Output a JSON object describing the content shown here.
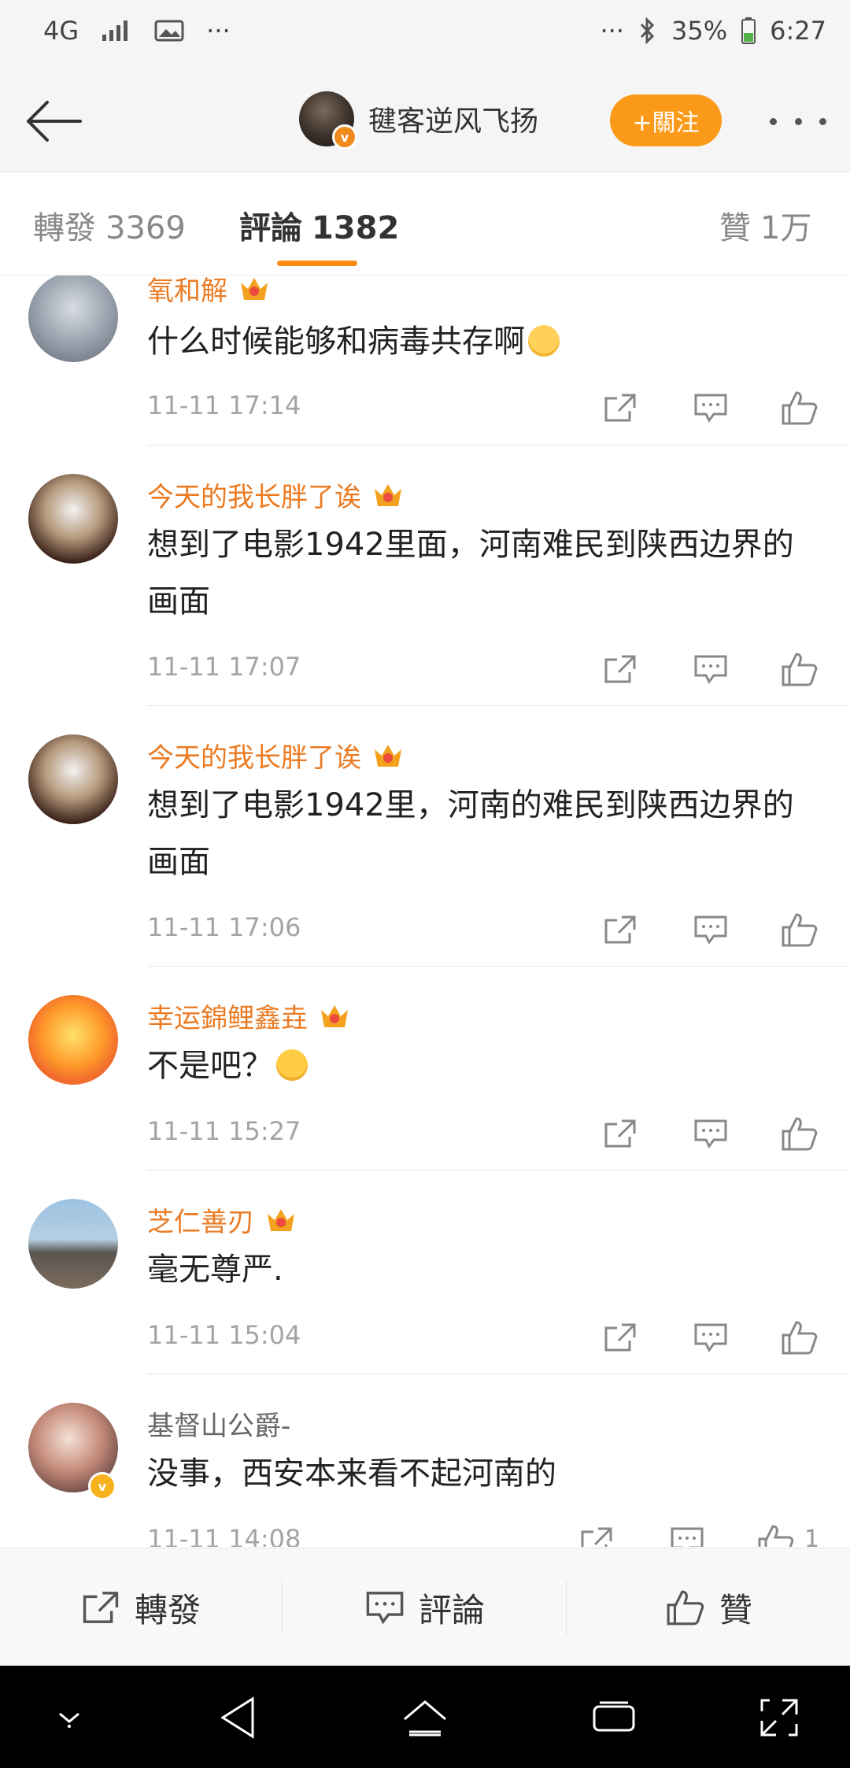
{
  "status_bar": {
    "network": "4G",
    "battery": "35%",
    "time": "6:27"
  },
  "header": {
    "profile_name": "毽客逆风飞扬",
    "follow_label": "+關注"
  },
  "tabs": [
    {
      "label": "轉發",
      "count": "3369"
    },
    {
      "label": "評論",
      "count": "1382"
    },
    {
      "label": "贊",
      "count": "1万"
    }
  ],
  "comments": [
    {
      "user": "氧和解",
      "text": "什么时候能够和病毒共存啊",
      "time": "11-11 17:14"
    },
    {
      "user": "今天的我长胖了诶",
      "text": "想到了电影1942里面，河南难民到陕西边界的画面",
      "time": "11-11 17:07"
    },
    {
      "user": "今天的我长胖了诶",
      "text": "想到了电影1942里，河南的难民到陕西边界的画面",
      "time": "11-11 17:06"
    },
    {
      "user": "幸运錦鲤鑫垚",
      "text": "不是吧？",
      "time": "11-11 15:27"
    },
    {
      "user": "芝仁善刃",
      "text": "毫无尊严.",
      "time": "11-11 15:04"
    },
    {
      "user": "基督山公爵-",
      "text": "没事，西安本来看不起河南的",
      "time": "11-11 14:08",
      "likes": "1"
    }
  ],
  "bottom_bar": {
    "repost": "轉發",
    "comment": "評論",
    "like": "贊"
  },
  "colors": {
    "accent": "#fb9a19",
    "username": "#eb7b23"
  }
}
